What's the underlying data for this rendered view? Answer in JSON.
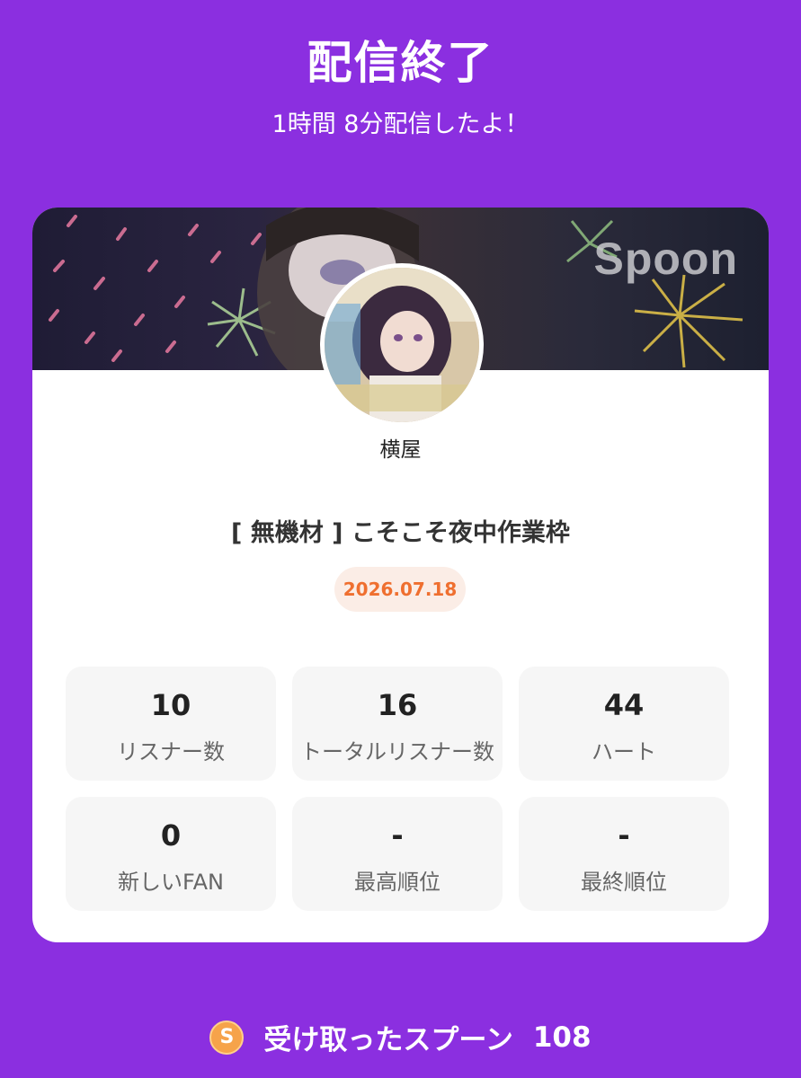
{
  "header": {
    "title": "配信終了",
    "subtitle": "1時間 8分配信したよ！"
  },
  "card": {
    "logo_text": "Spoon",
    "username": "横屋",
    "live_title": "[ 無機材 ] こそこそ夜中作業枠",
    "date": "2026.07.18",
    "stats": [
      {
        "value": "10",
        "label": "リスナー数"
      },
      {
        "value": "16",
        "label": "トータルリスナー数"
      },
      {
        "value": "44",
        "label": "ハート"
      },
      {
        "value": "0",
        "label": "新しいFAN"
      },
      {
        "value": "-",
        "label": "最高順位"
      },
      {
        "value": "-",
        "label": "最終順位"
      }
    ]
  },
  "footer": {
    "coin_symbol": "S",
    "label": "受け取ったスプーン",
    "count": "108"
  },
  "colors": {
    "background": "#8b2fe0",
    "card": "#ffffff",
    "date_badge_bg": "#fbede6",
    "date_badge_text": "#ef6f2f",
    "stat_bg": "#f6f6f6",
    "coin": "#f6a34a"
  }
}
